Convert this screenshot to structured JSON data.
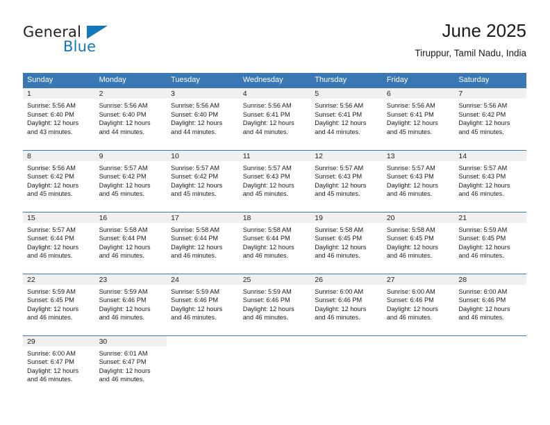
{
  "brand": {
    "name_top": "General",
    "name_bottom": "Blue",
    "color_dark": "#231f20",
    "color_blue": "#1277bc"
  },
  "header": {
    "title": "June 2025",
    "subtitle": "Tiruppur, Tamil Nadu, India"
  },
  "theme": {
    "header_blue": "#3a77b5",
    "daynum_band": "#f0f0f0",
    "text": "#1a1a1a"
  },
  "weekdays": [
    "Sunday",
    "Monday",
    "Tuesday",
    "Wednesday",
    "Thursday",
    "Friday",
    "Saturday"
  ],
  "weeks": [
    [
      {
        "day": "1",
        "l1": "Sunrise: 5:56 AM",
        "l2": "Sunset: 6:40 PM",
        "l3": "Daylight: 12 hours",
        "l4": "and 43 minutes."
      },
      {
        "day": "2",
        "l1": "Sunrise: 5:56 AM",
        "l2": "Sunset: 6:40 PM",
        "l3": "Daylight: 12 hours",
        "l4": "and 44 minutes."
      },
      {
        "day": "3",
        "l1": "Sunrise: 5:56 AM",
        "l2": "Sunset: 6:40 PM",
        "l3": "Daylight: 12 hours",
        "l4": "and 44 minutes."
      },
      {
        "day": "4",
        "l1": "Sunrise: 5:56 AM",
        "l2": "Sunset: 6:41 PM",
        "l3": "Daylight: 12 hours",
        "l4": "and 44 minutes."
      },
      {
        "day": "5",
        "l1": "Sunrise: 5:56 AM",
        "l2": "Sunset: 6:41 PM",
        "l3": "Daylight: 12 hours",
        "l4": "and 44 minutes."
      },
      {
        "day": "6",
        "l1": "Sunrise: 5:56 AM",
        "l2": "Sunset: 6:41 PM",
        "l3": "Daylight: 12 hours",
        "l4": "and 45 minutes."
      },
      {
        "day": "7",
        "l1": "Sunrise: 5:56 AM",
        "l2": "Sunset: 6:42 PM",
        "l3": "Daylight: 12 hours",
        "l4": "and 45 minutes."
      }
    ],
    [
      {
        "day": "8",
        "l1": "Sunrise: 5:56 AM",
        "l2": "Sunset: 6:42 PM",
        "l3": "Daylight: 12 hours",
        "l4": "and 45 minutes."
      },
      {
        "day": "9",
        "l1": "Sunrise: 5:57 AM",
        "l2": "Sunset: 6:42 PM",
        "l3": "Daylight: 12 hours",
        "l4": "and 45 minutes."
      },
      {
        "day": "10",
        "l1": "Sunrise: 5:57 AM",
        "l2": "Sunset: 6:42 PM",
        "l3": "Daylight: 12 hours",
        "l4": "and 45 minutes."
      },
      {
        "day": "11",
        "l1": "Sunrise: 5:57 AM",
        "l2": "Sunset: 6:43 PM",
        "l3": "Daylight: 12 hours",
        "l4": "and 45 minutes."
      },
      {
        "day": "12",
        "l1": "Sunrise: 5:57 AM",
        "l2": "Sunset: 6:43 PM",
        "l3": "Daylight: 12 hours",
        "l4": "and 45 minutes."
      },
      {
        "day": "13",
        "l1": "Sunrise: 5:57 AM",
        "l2": "Sunset: 6:43 PM",
        "l3": "Daylight: 12 hours",
        "l4": "and 46 minutes."
      },
      {
        "day": "14",
        "l1": "Sunrise: 5:57 AM",
        "l2": "Sunset: 6:43 PM",
        "l3": "Daylight: 12 hours",
        "l4": "and 46 minutes."
      }
    ],
    [
      {
        "day": "15",
        "l1": "Sunrise: 5:57 AM",
        "l2": "Sunset: 6:44 PM",
        "l3": "Daylight: 12 hours",
        "l4": "and 46 minutes."
      },
      {
        "day": "16",
        "l1": "Sunrise: 5:58 AM",
        "l2": "Sunset: 6:44 PM",
        "l3": "Daylight: 12 hours",
        "l4": "and 46 minutes."
      },
      {
        "day": "17",
        "l1": "Sunrise: 5:58 AM",
        "l2": "Sunset: 6:44 PM",
        "l3": "Daylight: 12 hours",
        "l4": "and 46 minutes."
      },
      {
        "day": "18",
        "l1": "Sunrise: 5:58 AM",
        "l2": "Sunset: 6:44 PM",
        "l3": "Daylight: 12 hours",
        "l4": "and 46 minutes."
      },
      {
        "day": "19",
        "l1": "Sunrise: 5:58 AM",
        "l2": "Sunset: 6:45 PM",
        "l3": "Daylight: 12 hours",
        "l4": "and 46 minutes."
      },
      {
        "day": "20",
        "l1": "Sunrise: 5:58 AM",
        "l2": "Sunset: 6:45 PM",
        "l3": "Daylight: 12 hours",
        "l4": "and 46 minutes."
      },
      {
        "day": "21",
        "l1": "Sunrise: 5:59 AM",
        "l2": "Sunset: 6:45 PM",
        "l3": "Daylight: 12 hours",
        "l4": "and 46 minutes."
      }
    ],
    [
      {
        "day": "22",
        "l1": "Sunrise: 5:59 AM",
        "l2": "Sunset: 6:45 PM",
        "l3": "Daylight: 12 hours",
        "l4": "and 46 minutes."
      },
      {
        "day": "23",
        "l1": "Sunrise: 5:59 AM",
        "l2": "Sunset: 6:46 PM",
        "l3": "Daylight: 12 hours",
        "l4": "and 46 minutes."
      },
      {
        "day": "24",
        "l1": "Sunrise: 5:59 AM",
        "l2": "Sunset: 6:46 PM",
        "l3": "Daylight: 12 hours",
        "l4": "and 46 minutes."
      },
      {
        "day": "25",
        "l1": "Sunrise: 5:59 AM",
        "l2": "Sunset: 6:46 PM",
        "l3": "Daylight: 12 hours",
        "l4": "and 46 minutes."
      },
      {
        "day": "26",
        "l1": "Sunrise: 6:00 AM",
        "l2": "Sunset: 6:46 PM",
        "l3": "Daylight: 12 hours",
        "l4": "and 46 minutes."
      },
      {
        "day": "27",
        "l1": "Sunrise: 6:00 AM",
        "l2": "Sunset: 6:46 PM",
        "l3": "Daylight: 12 hours",
        "l4": "and 46 minutes."
      },
      {
        "day": "28",
        "l1": "Sunrise: 6:00 AM",
        "l2": "Sunset: 6:46 PM",
        "l3": "Daylight: 12 hours",
        "l4": "and 46 minutes."
      }
    ],
    [
      {
        "day": "29",
        "l1": "Sunrise: 6:00 AM",
        "l2": "Sunset: 6:47 PM",
        "l3": "Daylight: 12 hours",
        "l4": "and 46 minutes."
      },
      {
        "day": "30",
        "l1": "Sunrise: 6:01 AM",
        "l2": "Sunset: 6:47 PM",
        "l3": "Daylight: 12 hours",
        "l4": "and 46 minutes."
      },
      {
        "day": "",
        "l1": "",
        "l2": "",
        "l3": "",
        "l4": ""
      },
      {
        "day": "",
        "l1": "",
        "l2": "",
        "l3": "",
        "l4": ""
      },
      {
        "day": "",
        "l1": "",
        "l2": "",
        "l3": "",
        "l4": ""
      },
      {
        "day": "",
        "l1": "",
        "l2": "",
        "l3": "",
        "l4": ""
      },
      {
        "day": "",
        "l1": "",
        "l2": "",
        "l3": "",
        "l4": ""
      }
    ]
  ]
}
